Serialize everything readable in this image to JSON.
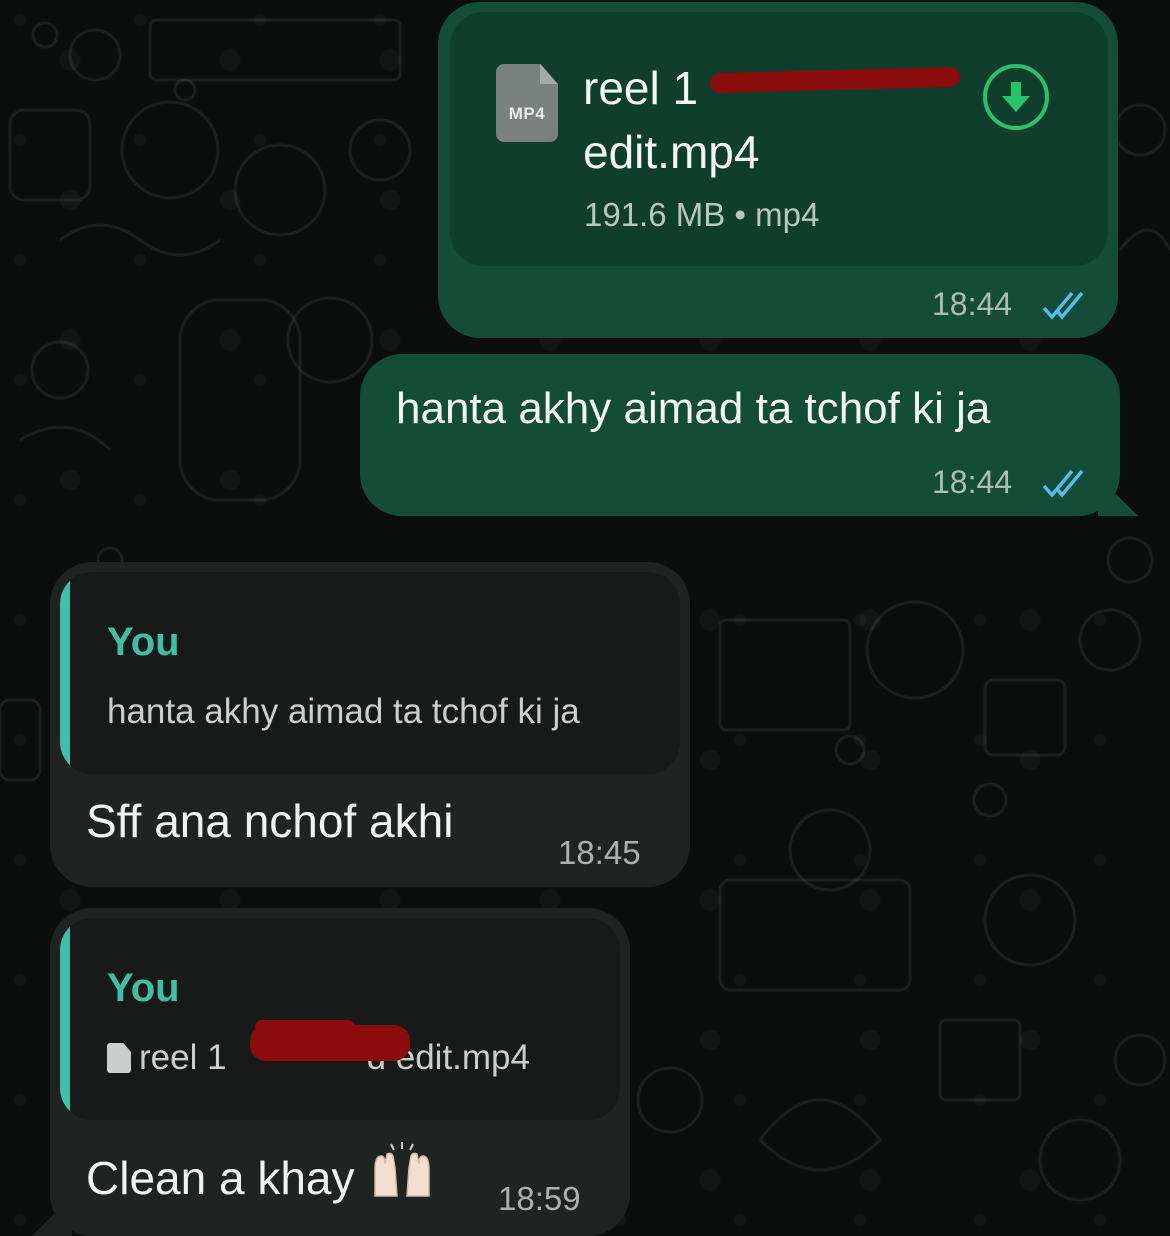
{
  "messages": {
    "file_message": {
      "file_ext": "MP4",
      "file_name_line1": "reel 1",
      "file_name_line2": "edit.mp4",
      "file_meta": "191.6 MB • mp4",
      "time": "18:44",
      "status_icon": "double-check-read-icon",
      "download_icon": "download-arrow-icon"
    },
    "text_message": {
      "text": "hanta akhy aimad ta tchof ki ja",
      "time": "18:44",
      "status_icon": "double-check-read-icon"
    },
    "reply_1": {
      "quote_author": "You",
      "quote_text": "hanta akhy aimad ta tchof ki ja",
      "text": "Sff ana nchof akhi",
      "time": "18:45"
    },
    "reply_2": {
      "quote_author": "You",
      "quote_file_start": "reel 1",
      "quote_file_end": "d edit.mp4",
      "quote_icon": "document-icon",
      "text": "Clean a khay",
      "emoji": "raising-hands-emoji",
      "time": "18:59"
    }
  },
  "colors": {
    "outgoing_bubble": "#144d37",
    "incoming_bubble": "#1f2322",
    "accent": "#3fbfa5",
    "download_green": "#27c26a",
    "read_tick": "#53bdeb",
    "redaction": "#8a0c0c"
  }
}
